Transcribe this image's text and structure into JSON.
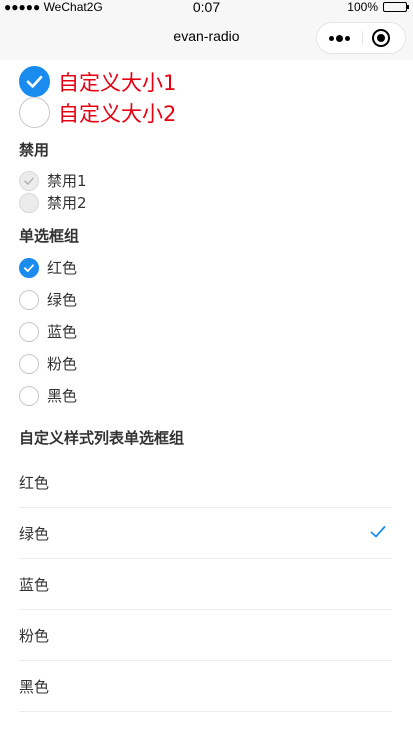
{
  "status_bar": {
    "carrier": "●●●●● WeChat2G",
    "time": "0:07",
    "battery_pct": "100%"
  },
  "nav": {
    "title": "evan-radio"
  },
  "custom_size": {
    "items": [
      {
        "label": "自定义大小1",
        "checked": true
      },
      {
        "label": "自定义大小2",
        "checked": false
      }
    ]
  },
  "disabled": {
    "title": "禁用",
    "items": [
      {
        "label": "禁用1",
        "checked": true
      },
      {
        "label": "禁用2",
        "checked": false
      }
    ]
  },
  "group": {
    "title": "单选框组",
    "items": [
      {
        "label": "红色",
        "checked": true
      },
      {
        "label": "绿色",
        "checked": false
      },
      {
        "label": "蓝色",
        "checked": false
      },
      {
        "label": "粉色",
        "checked": false
      },
      {
        "label": "黑色",
        "checked": false
      }
    ]
  },
  "list_group": {
    "title": "自定义样式列表单选框组",
    "items": [
      {
        "label": "红色",
        "checked": false
      },
      {
        "label": "绿色",
        "checked": true
      },
      {
        "label": "蓝色",
        "checked": false
      },
      {
        "label": "粉色",
        "checked": false
      },
      {
        "label": "黑色",
        "checked": false
      }
    ]
  },
  "colors": {
    "accent": "#1a8cf0",
    "custom_label": "#e60012"
  }
}
